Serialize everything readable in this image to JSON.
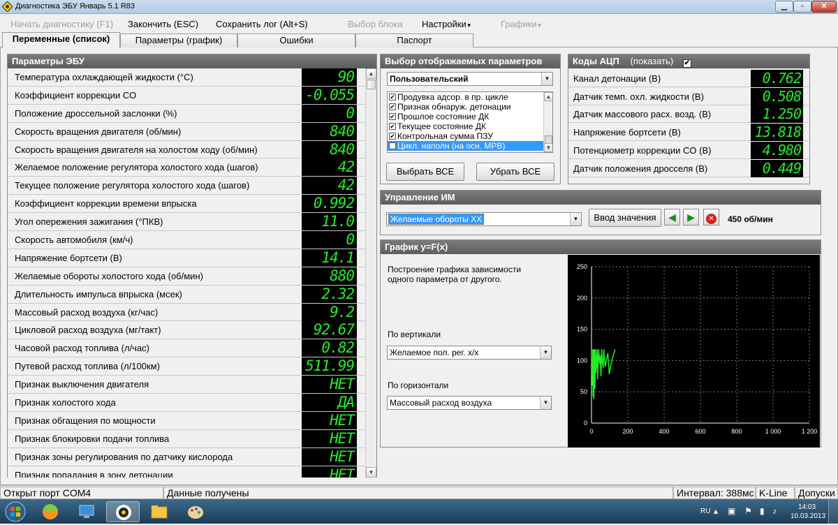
{
  "window": {
    "title": "Диагностика ЭБУ Январь 5.1 R83"
  },
  "menu": [
    {
      "label": "Начать диагностику (F1)",
      "disabled": true
    },
    {
      "label": "Закончить (ESC)",
      "disabled": false
    },
    {
      "label": "Сохранить лог (Alt+S)",
      "disabled": false
    },
    {
      "label": "Выбор блока",
      "disabled": true
    },
    {
      "label": "Настройки",
      "disabled": false
    },
    {
      "label": "Графики",
      "disabled": true
    }
  ],
  "tabs": [
    {
      "label": "Переменные (список)",
      "active": true
    },
    {
      "label": "Параметры (график)",
      "active": false
    },
    {
      "label": "Ошибки",
      "active": false
    },
    {
      "label": "Паспорт",
      "active": false
    }
  ],
  "ecu_panel": {
    "title": "Параметры ЭБУ",
    "rows": [
      {
        "label": "Температура охлаждающей жидкости (°C)",
        "value": "90"
      },
      {
        "label": "Коэффициент коррекции CO",
        "value": "-0.055"
      },
      {
        "label": "Положение дроссельной заслонки (%)",
        "value": "0"
      },
      {
        "label": "Скорость вращения двигателя (об/мин)",
        "value": "840"
      },
      {
        "label": "Скорость вращения двигателя на холостом ходу (об/мин)",
        "value": "840"
      },
      {
        "label": "Желаемое положение регулятора холостого хода (шагов)",
        "value": "42"
      },
      {
        "label": "Текущее положение регулятора холостого хода (шагов)",
        "value": "42"
      },
      {
        "label": "Коэффициент коррекции времени впрыска",
        "value": "0.992"
      },
      {
        "label": "Угол опережения зажигания (°ПКВ)",
        "value": "11.0"
      },
      {
        "label": "Скорость автомобиля (км/ч)",
        "value": "0"
      },
      {
        "label": "Напряжение бортсети (В)",
        "value": "14.1"
      },
      {
        "label": "Желаемые обороты холостого хода (об/мин)",
        "value": "880"
      },
      {
        "label": "Длительность импульса впрыска (мсек)",
        "value": "2.32"
      },
      {
        "label": "Массовый расход воздуха (кг/час)",
        "value": "9.2"
      },
      {
        "label": "Цикловой расход воздуха (мг/такт)",
        "value": "92.67"
      },
      {
        "label": "Часовой расход топлива (л/час)",
        "value": "0.82"
      },
      {
        "label": "Путевой расход топлива (л/100км)",
        "value": "511.99"
      },
      {
        "label": "Признак выключения двигателя",
        "value": "НЕТ"
      },
      {
        "label": "Признак холостого хода",
        "value": "ДА"
      },
      {
        "label": "Признак обгащения по мощности",
        "value": "НЕТ"
      },
      {
        "label": "Признак блокировки подачи топлива",
        "value": "НЕТ"
      },
      {
        "label": "Признак зоны регулирования по датчику кислорода",
        "value": "НЕТ"
      },
      {
        "label": "Признак попадания в зону детонации",
        "value": "НЕТ"
      }
    ]
  },
  "param_select": {
    "title": "Выбор отображаемых параметров",
    "preset": "Пользовательский",
    "items": [
      {
        "label": "Продувка адсор. в пр. цикле",
        "checked": true,
        "selected": false
      },
      {
        "label": "Признак обнаруж. детонации",
        "checked": true,
        "selected": false
      },
      {
        "label": "Прошлое состояние ДК",
        "checked": true,
        "selected": false
      },
      {
        "label": "Текущее состояние ДК",
        "checked": true,
        "selected": false
      },
      {
        "label": "Контрольная сумма ПЗУ",
        "checked": true,
        "selected": false
      },
      {
        "label": "Цикл. наполн (на осн. МРВ)",
        "checked": true,
        "selected": true
      }
    ],
    "select_all": "Выбрать ВСЕ",
    "deselect_all": "Убрать ВСЕ"
  },
  "adc": {
    "title": "Коды АЦП",
    "show_label": "(показать)",
    "show_checked": true,
    "rows": [
      {
        "label": "Канал детонации (В)",
        "value": "0.762"
      },
      {
        "label": "Датчик темп. охл. жидкости (В)",
        "value": "0.508"
      },
      {
        "label": "Датчик массового расх. возд. (В)",
        "value": "1.250"
      },
      {
        "label": "Напряжение бортсети (В)",
        "value": "13.818"
      },
      {
        "label": "Потенциометр коррекции CO (В)",
        "value": "4.980"
      },
      {
        "label": "Датчик положения дросселя (В)",
        "value": "0.449"
      }
    ]
  },
  "im_control": {
    "title": "Управление ИМ",
    "selected": "Желаемые обороты ХХ",
    "enter_value": "Ввод значения",
    "value_text": "450 об/мин"
  },
  "graph": {
    "title": "График y=F(x)",
    "description": "Построение графика зависимости одного параметра от другого.",
    "vertical_label": "По вертикали",
    "vertical_value": "Желаемое пол. рег. х/х",
    "horizontal_label": "По горизонтали",
    "horizontal_value": "Массовый расход воздуха"
  },
  "chart_data": {
    "type": "line",
    "xlim": [
      0,
      1200
    ],
    "ylim": [
      0,
      250
    ],
    "xticks": [
      "0",
      "200",
      "400",
      "600",
      "800",
      "1 000",
      "1 200"
    ],
    "yticks": [
      "0",
      "50",
      "100",
      "150",
      "200",
      "250"
    ],
    "grid": true,
    "x": [
      5,
      7,
      9,
      11,
      13,
      16,
      19,
      22,
      25,
      28,
      31,
      34,
      37,
      40,
      44,
      48,
      52,
      56,
      60,
      64,
      68,
      75,
      82,
      90,
      98,
      106,
      114,
      122,
      130
    ],
    "y": [
      60,
      118,
      42,
      118,
      38,
      118,
      55,
      118,
      80,
      100,
      118,
      70,
      105,
      118,
      95,
      108,
      75,
      118,
      98,
      88,
      118,
      90,
      100,
      112,
      78,
      92,
      102,
      110,
      118
    ],
    "color": "#22ee22"
  },
  "statusbar": {
    "port": "Открыт порт COM4",
    "status": "Данные получены",
    "interval": "Интервал: 388мс",
    "protocol": "K-Line",
    "extra": "Допуски"
  },
  "taskbar": {
    "lang": "RU",
    "time": "14:03",
    "date": "10.03.2013"
  }
}
